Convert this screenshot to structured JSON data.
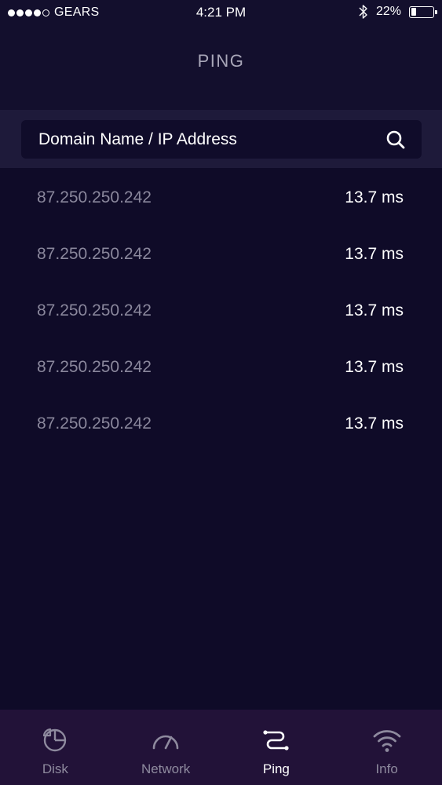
{
  "status_bar": {
    "carrier": "GEARS",
    "time": "4:21 PM",
    "battery_percent": "22%",
    "battery_level": 0.22,
    "signal_bars": 4,
    "signal_max": 5
  },
  "nav": {
    "title": "PING"
  },
  "search": {
    "placeholder": "Domain Name / IP Address",
    "icon": "search-icon"
  },
  "results": [
    {
      "ip": "87.250.250.242",
      "time": "13.7 ms"
    },
    {
      "ip": "87.250.250.242",
      "time": "13.7 ms"
    },
    {
      "ip": "87.250.250.242",
      "time": "13.7 ms"
    },
    {
      "ip": "87.250.250.242",
      "time": "13.7 ms"
    },
    {
      "ip": "87.250.250.242",
      "time": "13.7 ms"
    }
  ],
  "tabs": [
    {
      "label": "Disk",
      "icon": "pie-chart-icon",
      "active": false
    },
    {
      "label": "Network",
      "icon": "speedometer-icon",
      "active": false
    },
    {
      "label": "Ping",
      "icon": "ping-route-icon",
      "active": true
    },
    {
      "label": "Info",
      "icon": "wifi-icon",
      "active": false
    }
  ],
  "colors": {
    "background": "#0f0b28",
    "search_band": "#1e1a3a",
    "tab_bar": "#221238",
    "muted_text": "#8a879c",
    "active_tab": "#ffffff",
    "inactive_tab": "#8e8a9e"
  }
}
